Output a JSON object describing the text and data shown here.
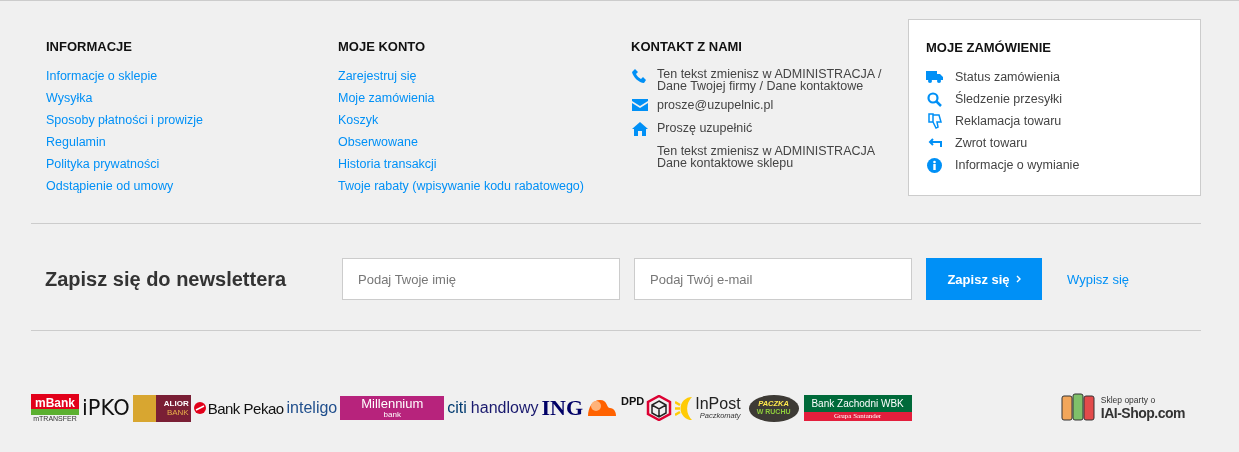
{
  "columns": [
    {
      "kind": "links",
      "title": "INFORMACJE",
      "items": [
        "Informacje o sklepie",
        "Wysyłka",
        "Sposoby płatności i prowizje",
        "Regulamin",
        "Polityka prywatności",
        "Odstąpienie od umowy"
      ]
    },
    {
      "kind": "links",
      "title": "MOJE KONTO",
      "items": [
        "Zarejestruj się",
        "Moje zamówienia",
        "Koszyk",
        "Obserwowane",
        "Historia transakcji",
        "Twoje rabaty (wpisywanie kodu rabatowego)"
      ]
    },
    {
      "kind": "contact",
      "title": "KONTAKT Z NAMI",
      "items": [
        {
          "lines": [
            "Ten tekst zmienisz w ADMINISTRACJA /",
            "Dane Twojej firmy / Dane kontaktowe"
          ]
        },
        {
          "lines": [
            "prosze@uzupelnic.pl"
          ]
        },
        {
          "lines": [
            "Proszę uzupełnić"
          ]
        },
        {
          "lines": [
            "Ten tekst zmienisz w ADMINISTRACJA",
            "Dane kontaktowe sklepu"
          ]
        }
      ]
    },
    {
      "kind": "orders",
      "title": "MOJE ZAMÓWIENIE",
      "items": [
        {
          "label": "Status zamówienia"
        },
        {
          "label": "Śledzenie przesyłki"
        },
        {
          "label": "Reklamacja towaru"
        },
        {
          "label": "Zwrot towaru"
        },
        {
          "label": "Informacje o wymianie"
        }
      ]
    }
  ],
  "newsletter": {
    "title": "Zapisz się do newslettera",
    "name_placeholder": "Podaj Twoje imię",
    "email_placeholder": "Podaj Twój e-mail",
    "submit": "Zapisz się",
    "unsubscribe": "Wypisz się"
  },
  "logos": [
    {
      "kind": "mbank",
      "text": "mBank",
      "sub": "mTRANSFER"
    },
    {
      "kind": "ipko",
      "text": "iPKO"
    },
    {
      "kind": "alior",
      "text": "ALIOR",
      "sub": "BANK"
    },
    {
      "kind": "pekao",
      "text": "Bank Pekao"
    },
    {
      "kind": "inteligo",
      "text": "inteligo"
    },
    {
      "kind": "millennium",
      "text": "Millennium",
      "sub": "bank"
    },
    {
      "kind": "citi",
      "text": "citi",
      "sub": "handlowy"
    },
    {
      "kind": "ing",
      "text": "ING"
    },
    {
      "kind": "dpd",
      "text": "DPD"
    },
    {
      "kind": "inpost",
      "text": "InPost",
      "sub": "Paczkomaty"
    },
    {
      "kind": "ruch",
      "text": "PACZKA",
      "sub": "W RUCHU"
    },
    {
      "kind": "bzwbk",
      "text": "Bank Zachodni WBK",
      "sub": "Grupa Santander"
    }
  ],
  "platform": {
    "caption": "Sklep oparty o",
    "name": "IAI-Shop.com"
  }
}
